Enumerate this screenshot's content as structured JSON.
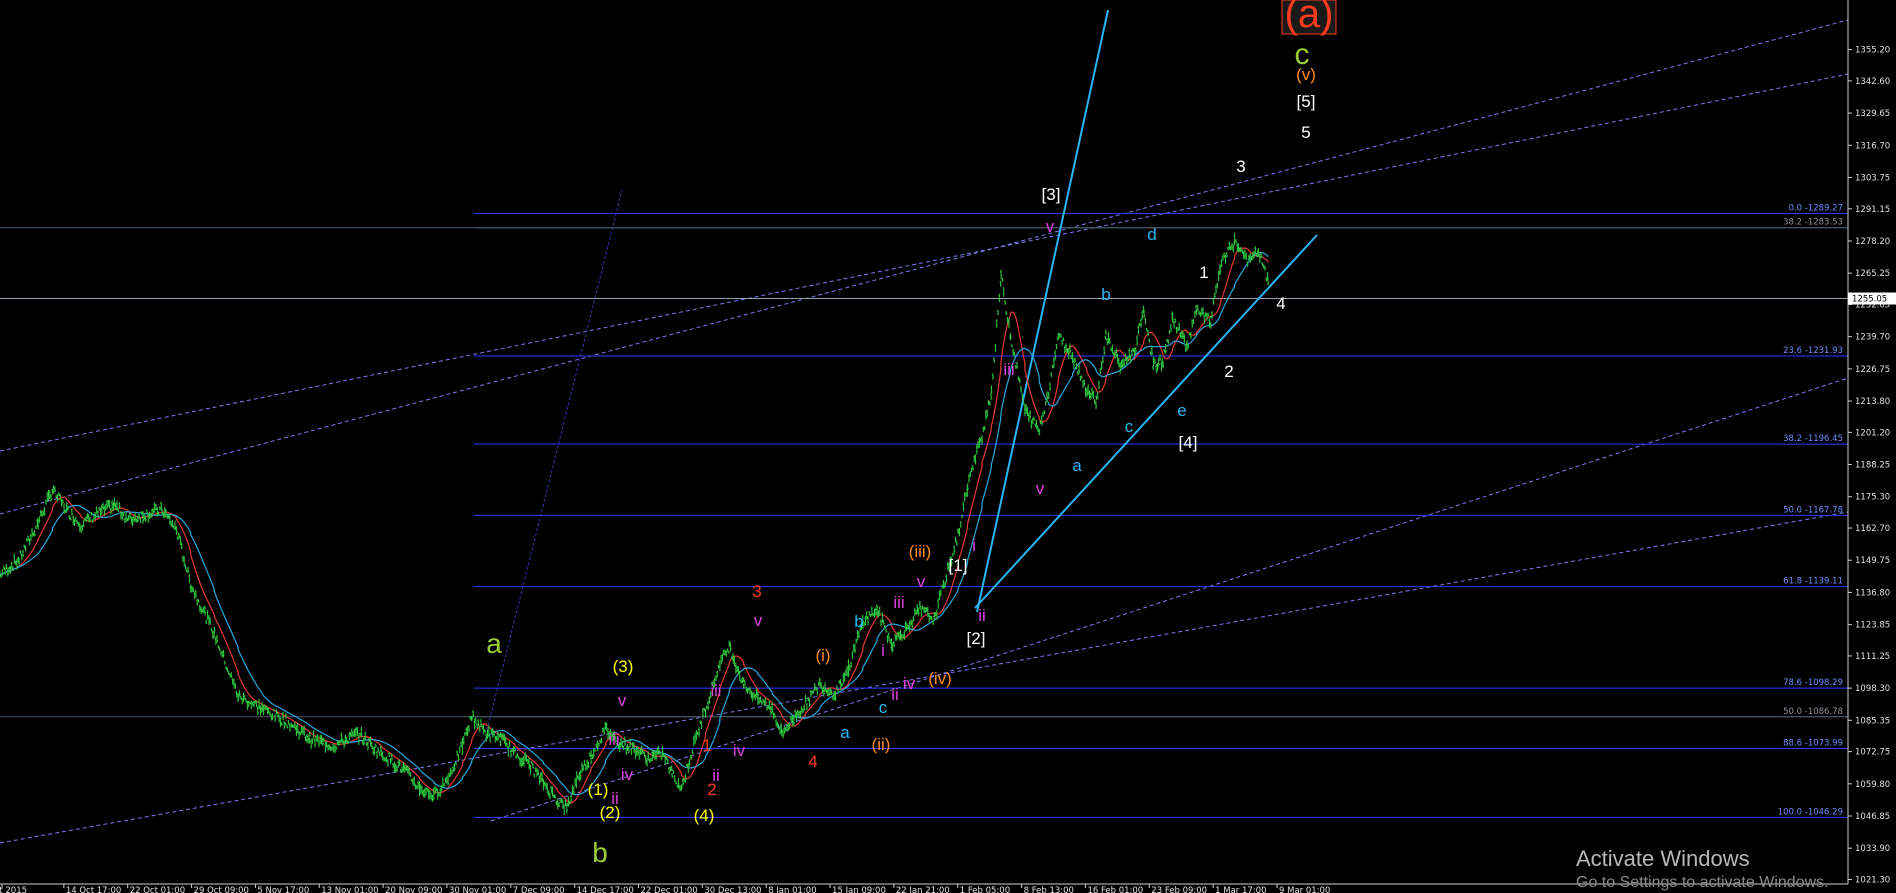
{
  "chart_data": {
    "type": "line",
    "instrument_style": "candlestick-bars",
    "title": "",
    "xlabel": "",
    "ylabel": "",
    "ylim": [
      1021.1,
      1366.7
    ],
    "grid": false,
    "price_ticks": [
      "1355.20",
      "1342.60",
      "1329.65",
      "1316.70",
      "1303.75",
      "1291.15",
      "1278.20",
      "1265.25",
      "1252.65",
      "1239.70",
      "1226.75",
      "1213.80",
      "1201.20",
      "1188.25",
      "1175.30",
      "1162.70",
      "1149.75",
      "1136.80",
      "1123.85",
      "1111.25",
      "1098.30",
      "1085.35",
      "1072.75",
      "1059.80",
      "1046.85",
      "1033.90",
      "1021.30"
    ],
    "current_price": "1255.05",
    "time_labels": [
      "Oct 2015",
      "14 Oct 17:00",
      "22 Oct 01:00",
      "29 Oct 09:00",
      "5 Nov 17:00",
      "13 Nov 01:00",
      "20 Nov 09:00",
      "30 Nov 01:00",
      "7 Dec 09:00",
      "14 Dec 17:00",
      "22 Dec 01:00",
      "30 Dec 13:00",
      "8 Jan 01:00",
      "15 Jan 09:00",
      "22 Jan 21:00",
      "1 Feb 05:00",
      "8 Feb 13:00",
      "16 Feb 01:00",
      "23 Feb 09:00",
      "1 Mar 17:00",
      "9 Mar 01:00"
    ],
    "price_path": [
      [
        0,
        1144
      ],
      [
        4,
        1150
      ],
      [
        8,
        1165
      ],
      [
        11,
        1178
      ],
      [
        14,
        1170
      ],
      [
        17,
        1164
      ],
      [
        20,
        1168
      ],
      [
        24,
        1172
      ],
      [
        27,
        1166
      ],
      [
        30,
        1168
      ],
      [
        34,
        1170
      ],
      [
        37,
        1162
      ],
      [
        40,
        1140
      ],
      [
        45,
        1120
      ],
      [
        50,
        1095
      ],
      [
        55,
        1090
      ],
      [
        60,
        1085
      ],
      [
        65,
        1078
      ],
      [
        70,
        1075
      ],
      [
        75,
        1080
      ],
      [
        80,
        1072
      ],
      [
        85,
        1065
      ],
      [
        88,
        1058
      ],
      [
        91,
        1055
      ],
      [
        94,
        1062
      ],
      [
        97,
        1075
      ],
      [
        99,
        1087
      ],
      [
        102,
        1080
      ],
      [
        105,
        1078
      ],
      [
        108,
        1072
      ],
      [
        111,
        1068
      ],
      [
        114,
        1060
      ],
      [
        117,
        1053
      ],
      [
        119,
        1050
      ],
      [
        121,
        1062
      ],
      [
        124,
        1071
      ],
      [
        127,
        1082
      ],
      [
        130,
        1076
      ],
      [
        133,
        1074
      ],
      [
        136,
        1070
      ],
      [
        139,
        1072
      ],
      [
        141,
        1064
      ],
      [
        143,
        1058
      ],
      [
        145,
        1072
      ],
      [
        148,
        1090
      ],
      [
        151,
        1108
      ],
      [
        153,
        1115
      ],
      [
        156,
        1100
      ],
      [
        159,
        1094
      ],
      [
        162,
        1090
      ],
      [
        164,
        1080
      ],
      [
        166,
        1085
      ],
      [
        169,
        1092
      ],
      [
        172,
        1100
      ],
      [
        175,
        1096
      ],
      [
        178,
        1106
      ],
      [
        181,
        1125
      ],
      [
        184,
        1130
      ],
      [
        187,
        1116
      ],
      [
        190,
        1122
      ],
      [
        193,
        1130
      ],
      [
        196,
        1126
      ],
      [
        198,
        1140
      ],
      [
        201,
        1160
      ],
      [
        203,
        1180
      ],
      [
        206,
        1200
      ],
      [
        208,
        1218
      ],
      [
        210,
        1264
      ],
      [
        212,
        1240
      ],
      [
        215,
        1210
      ],
      [
        218,
        1202
      ],
      [
        220,
        1218
      ],
      [
        222,
        1240
      ],
      [
        225,
        1232
      ],
      [
        228,
        1218
      ],
      [
        230,
        1214
      ],
      [
        232,
        1240
      ],
      [
        235,
        1228
      ],
      [
        238,
        1234
      ],
      [
        240,
        1250
      ],
      [
        242,
        1228
      ],
      [
        244,
        1230
      ],
      [
        246,
        1247
      ],
      [
        249,
        1236
      ],
      [
        251,
        1250
      ],
      [
        254,
        1246
      ],
      [
        256,
        1268
      ],
      [
        259,
        1278
      ],
      [
        262,
        1270
      ],
      [
        264,
        1274
      ],
      [
        266,
        1262
      ]
    ],
    "fib_levels": [
      {
        "label": "0.0 -1289.27",
        "value": 1289.27
      },
      {
        "label": "38.2 -1283.53",
        "value": 1283.53
      },
      {
        "label": "23.6 -1231.93",
        "value": 1231.93
      },
      {
        "label": "38.2 -1196.45",
        "value": 1196.45
      },
      {
        "label": "50.0 -1167.78",
        "value": 1167.78
      },
      {
        "label": "61.8 -1139.11",
        "value": 1139.11
      },
      {
        "label": "78.6 -1098.29",
        "value": 1098.29
      },
      {
        "label": "50.0 -1086.78",
        "value": 1086.78
      },
      {
        "label": "88.6 -1073.99",
        "value": 1073.99
      },
      {
        "label": "100.0 -1046.29",
        "value": 1046.29
      }
    ],
    "wave_labels": [
      {
        "text": "(a)",
        "color": "#ff3b1f",
        "boxed": true
      },
      {
        "text": "c",
        "color": "#9acd32"
      },
      {
        "text": "(v)",
        "color": "#ff8c1a"
      },
      {
        "text": "[5]",
        "color": "#ffffff"
      },
      {
        "text": "5",
        "color": "#ffffff"
      },
      {
        "text": "3",
        "color": "#ffffff"
      },
      {
        "text": "[3]",
        "color": "#ffffff"
      },
      {
        "text": "v",
        "color": "#e040e0"
      },
      {
        "text": "d",
        "color": "#29b6f6"
      },
      {
        "text": "b",
        "color": "#29b6f6"
      },
      {
        "text": "1",
        "color": "#ffffff"
      },
      {
        "text": "4",
        "color": "#ffffff"
      },
      {
        "text": "2",
        "color": "#ffffff"
      },
      {
        "text": "iii",
        "color": "#e040e0"
      },
      {
        "text": "c",
        "color": "#29b6f6"
      },
      {
        "text": "e",
        "color": "#29b6f6"
      },
      {
        "text": "[4]",
        "color": "#ffffff"
      },
      {
        "text": "a",
        "color": "#29b6f6"
      },
      {
        "text": "v",
        "color": "#e040e0"
      },
      {
        "text": "(iii)",
        "color": "#ff8c1a"
      },
      {
        "text": "i",
        "color": "#e040e0"
      },
      {
        "text": "[1]",
        "color": "#ffffff"
      },
      {
        "text": "v",
        "color": "#e040e0"
      },
      {
        "text": "iii",
        "color": "#e040e0"
      },
      {
        "text": "ii",
        "color": "#e040e0"
      },
      {
        "text": "[2]",
        "color": "#ffffff"
      },
      {
        "text": "3",
        "color": "#ff3b1f"
      },
      {
        "text": "v",
        "color": "#e040e0"
      },
      {
        "text": "b",
        "color": "#29b6f6"
      },
      {
        "text": "(i)",
        "color": "#ff8c1a"
      },
      {
        "text": "i",
        "color": "#e040e0"
      },
      {
        "text": "iii",
        "color": "#e040e0"
      },
      {
        "text": "(iv)",
        "color": "#ff8c1a"
      },
      {
        "text": "iv",
        "color": "#e040e0"
      },
      {
        "text": "ii",
        "color": "#e040e0"
      },
      {
        "text": "c",
        "color": "#29b6f6"
      },
      {
        "text": "a",
        "color": "#9acd32"
      },
      {
        "text": "(3)",
        "color": "#ffff00"
      },
      {
        "text": "v",
        "color": "#e040e0"
      },
      {
        "text": "iii",
        "color": "#e040e0"
      },
      {
        "text": "iv",
        "color": "#e040e0"
      },
      {
        "text": "1",
        "color": "#ff3b1f"
      },
      {
        "text": "iv",
        "color": "#e040e0"
      },
      {
        "text": "a",
        "color": "#29b6f6"
      },
      {
        "text": "4",
        "color": "#ff3b1f"
      },
      {
        "text": "(ii)",
        "color": "#ff8c1a"
      },
      {
        "text": "ii",
        "color": "#e040e0"
      },
      {
        "text": "2",
        "color": "#ff3b1f"
      },
      {
        "text": "(1)",
        "color": "#ffff00"
      },
      {
        "text": "ii",
        "color": "#e040e0"
      },
      {
        "text": "(2)",
        "color": "#ffff00"
      },
      {
        "text": "(4)",
        "color": "#ffff00"
      },
      {
        "text": "b",
        "color": "#9acd32"
      }
    ]
  },
  "watermark": {
    "title": "Activate Windows",
    "subtitle": "Go to Settings to activate Windows."
  }
}
